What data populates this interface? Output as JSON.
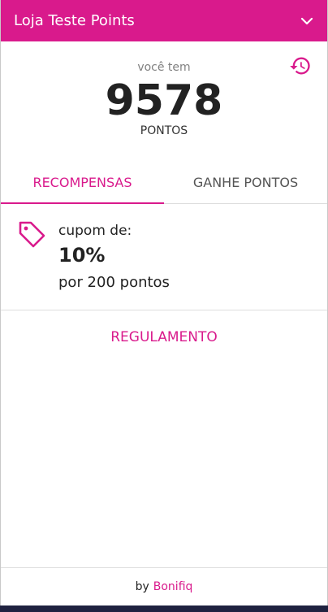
{
  "header": {
    "title": "Loja Teste Points",
    "toggle_icon": "chevron-down-icon"
  },
  "history": {
    "icon": "history-icon"
  },
  "balance": {
    "label": "você tem",
    "value": "9578",
    "unit": "PONTOS"
  },
  "tabs": [
    {
      "label": "RECOMPENSAS",
      "active": true
    },
    {
      "label": "GANHE PONTOS",
      "active": false
    }
  ],
  "rewards": [
    {
      "icon": "tag-icon",
      "label": "cupom de:",
      "value": "10%",
      "cost": "por 200 pontos"
    }
  ],
  "regulamento": {
    "label": "REGULAMENTO"
  },
  "footer": {
    "prefix": "by",
    "brand": "Bonifiq"
  },
  "colors": {
    "accent": "#d91a8c",
    "text_dark": "#222222",
    "text_muted": "#808080",
    "bottom_bar": "#1f2240"
  }
}
